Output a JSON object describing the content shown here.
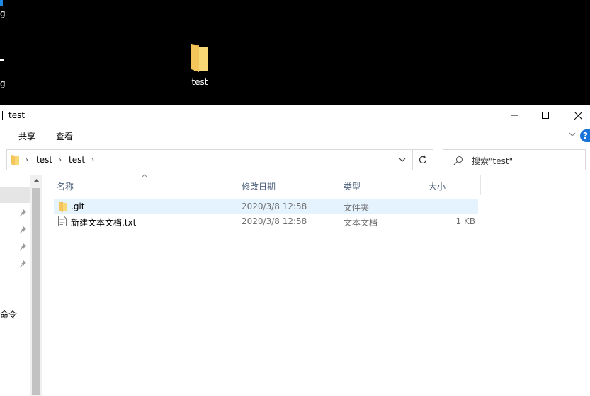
{
  "desktop": {
    "icon_test_label": "test",
    "partial_label_1": "g",
    "partial_label_2": "g"
  },
  "window": {
    "title": "test",
    "controls": {
      "minimize": "minimize",
      "maximize": "maximize",
      "close": "close"
    }
  },
  "ribbon": {
    "tabs": [
      "共享",
      "查看"
    ],
    "help": "?"
  },
  "address": {
    "crumbs": [
      "test",
      "test"
    ]
  },
  "search": {
    "placeholder": "搜索\"test\""
  },
  "nav": {
    "partial_item": "命令"
  },
  "columns": {
    "name": "名称",
    "date": "修改日期",
    "type": "类型",
    "size": "大小"
  },
  "files": [
    {
      "name": ".git",
      "date": "2020/3/8 12:58",
      "type": "文件夹",
      "size": "",
      "icon": "folder-icon"
    },
    {
      "name": "新建文本文档.txt",
      "date": "2020/3/8 12:58",
      "type": "文本文档",
      "size": "1 KB",
      "icon": "text-file-icon"
    }
  ],
  "colors": {
    "folder": "#f8d775",
    "selection": "#e5f3ff",
    "header_text": "#4c607a",
    "help_blue": "#1a73d9"
  }
}
